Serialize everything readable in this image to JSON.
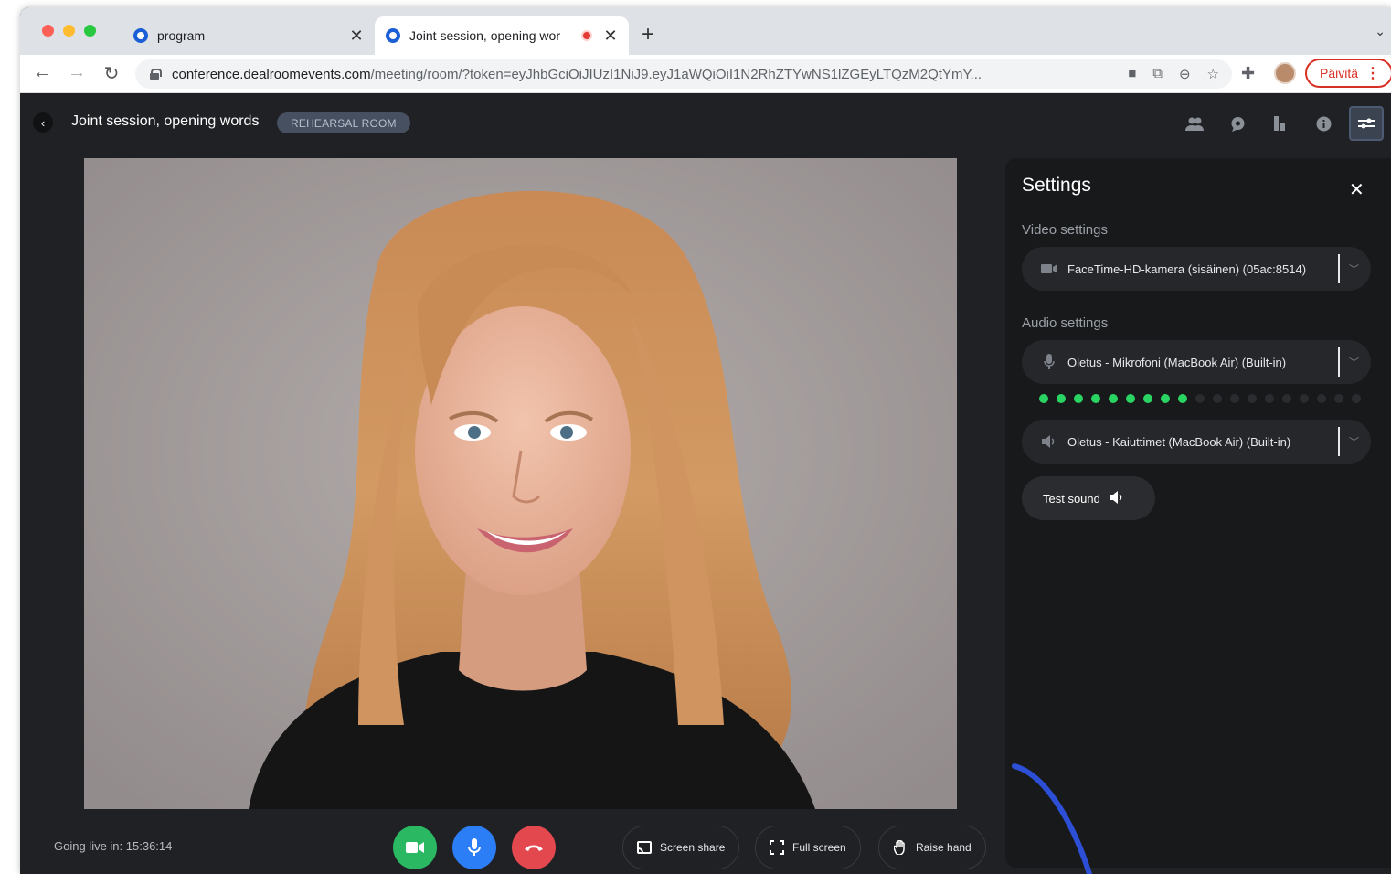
{
  "browser": {
    "tabs": [
      {
        "title": "program",
        "active": false
      },
      {
        "title": "Joint session, opening wor",
        "active": true,
        "recording": true
      }
    ],
    "new_tab_label": "+",
    "url_host": "conference.dealroomevents.com",
    "url_path": "/meeting/room/?token=eyJhbGciOiJIUzI1NiJ9.eyJ1aWQiOiI1N2RhZTYwNS1lZGEyLTQzM2QtYmY...",
    "update_label": "Päivitä"
  },
  "app": {
    "session_title": "Joint session, opening words",
    "room_badge": "REHEARSAL ROOM",
    "header_icons": [
      "people-icon",
      "chat-icon",
      "poll-icon",
      "info-icon",
      "settings-sliders-icon"
    ],
    "active_header_icon": "settings-sliders-icon"
  },
  "bottom_bar": {
    "going_live": "Going live in: 15:36:14",
    "screen_share_label": "Screen share",
    "full_screen_label": "Full screen",
    "raise_hand_label": "Raise hand"
  },
  "settings": {
    "title": "Settings",
    "video_label": "Video settings",
    "camera_device": "FaceTime-HD-kamera (sisäinen) (05ac:8514)",
    "audio_label": "Audio settings",
    "mic_device": "Oletus - Mikrofoni (MacBook Air) (Built-in)",
    "mic_level_active": 9,
    "mic_level_total": 19,
    "speaker_device": "Oletus - Kaiuttimet (MacBook Air) (Built-in)",
    "test_sound_label": "Test sound"
  },
  "colors": {
    "camera_button": "#2ab863",
    "mic_button": "#2b7ef5",
    "hangup_button": "#e3484f",
    "meter_on": "#2ad462",
    "update_red": "#d93025"
  }
}
